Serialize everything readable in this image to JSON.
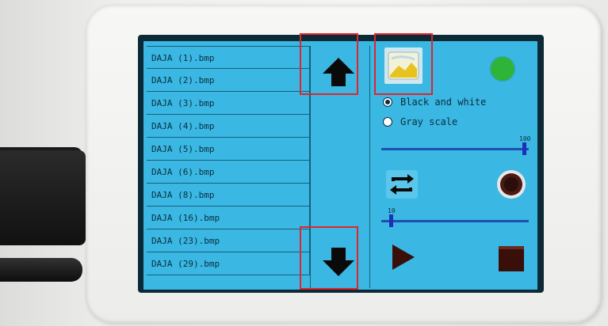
{
  "files": [
    "DAJA (1).bmp",
    "DAJA (2).bmp",
    "DAJA (3).bmp",
    "DAJA (4).bmp",
    "DAJA (5).bmp",
    "DAJA (6).bmp",
    "DAJA (8).bmp",
    "DAJA (16).bmp",
    "DAJA (23).bmp",
    "DAJA (29).bmp"
  ],
  "mode": {
    "options": [
      "Black and white",
      "Gray scale"
    ],
    "selected": "Black and white"
  },
  "slider_top": {
    "label": "100",
    "value": 100,
    "max": 100
  },
  "slider_bottom": {
    "label": "10",
    "value": 10,
    "max": 100
  },
  "icons": {
    "scroll_up": "arrow-up-icon",
    "scroll_down": "arrow-down-icon",
    "image": "image-thumbnail-icon",
    "status": "status-indicator-icon",
    "repeat": "repeat-icon",
    "rotate": "rotate-icon",
    "play": "play-icon",
    "stop": "stop-icon"
  },
  "colors": {
    "screen": "#3ab7e3",
    "status": "#2fb43a",
    "highlight": "#e0252b",
    "slider": "#1e4fb0"
  }
}
